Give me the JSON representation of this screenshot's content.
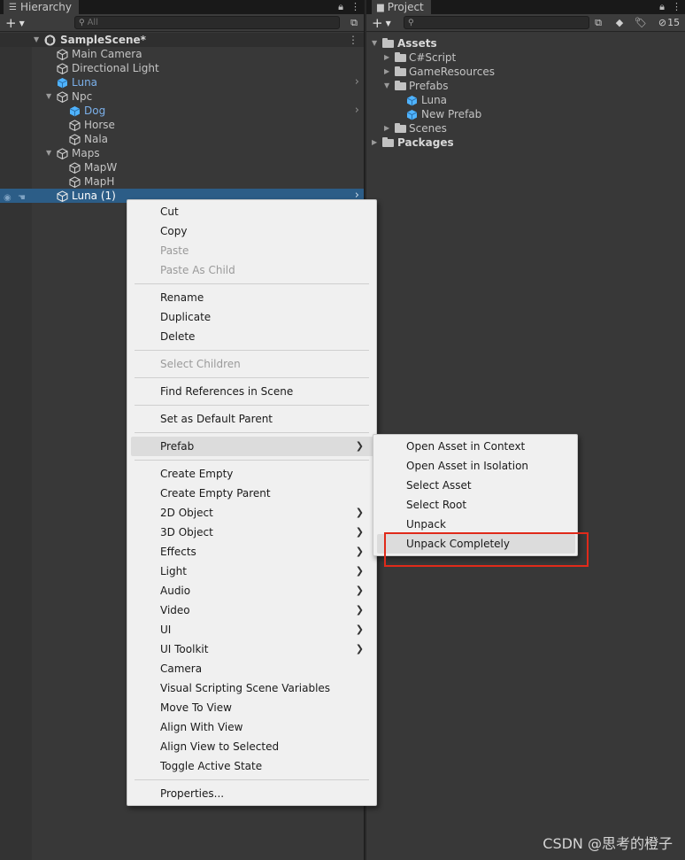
{
  "hierarchy": {
    "tab_title": "Hierarchy",
    "search_placeholder": "All",
    "scene_name": "SampleScene*",
    "items": [
      {
        "label": "Main Camera",
        "depth": 1
      },
      {
        "label": "Directional Light",
        "depth": 1
      },
      {
        "label": "Luna",
        "depth": 1,
        "prefab": true
      },
      {
        "label": "Npc",
        "depth": 1
      },
      {
        "label": "Dog",
        "depth": 2,
        "prefab": true
      },
      {
        "label": "Horse",
        "depth": 2
      },
      {
        "label": "Nala",
        "depth": 2
      },
      {
        "label": "Maps",
        "depth": 1
      },
      {
        "label": "MapW",
        "depth": 2
      },
      {
        "label": "MapH",
        "depth": 2
      },
      {
        "label": "Luna (1)",
        "depth": 1,
        "selected": true
      }
    ]
  },
  "project": {
    "tab_title": "Project",
    "hidden_count": "15",
    "tree": {
      "assets": "Assets",
      "csharp": "C#Script",
      "gameresources": "GameResources",
      "prefabs": "Prefabs",
      "prefab_luna": "Luna",
      "prefab_new": "New Prefab",
      "scenes": "Scenes",
      "packages": "Packages"
    }
  },
  "context_menu": {
    "cut": "Cut",
    "copy": "Copy",
    "paste": "Paste",
    "paste_as_child": "Paste As Child",
    "rename": "Rename",
    "duplicate": "Duplicate",
    "delete": "Delete",
    "select_children": "Select Children",
    "find_references": "Find References in Scene",
    "set_default_parent": "Set as Default Parent",
    "prefab": "Prefab",
    "create_empty": "Create Empty",
    "create_empty_parent": "Create Empty Parent",
    "obj_2d": "2D Object",
    "obj_3d": "3D Object",
    "effects": "Effects",
    "light": "Light",
    "audio": "Audio",
    "video": "Video",
    "ui": "UI",
    "ui_toolkit": "UI Toolkit",
    "camera": "Camera",
    "visual_scripting": "Visual Scripting Scene Variables",
    "move_to_view": "Move To View",
    "align_with_view": "Align With View",
    "align_view_to_selected": "Align View to Selected",
    "toggle_active": "Toggle Active State",
    "properties": "Properties..."
  },
  "prefab_submenu": {
    "open_context": "Open Asset in Context",
    "open_isolation": "Open Asset in Isolation",
    "select_asset": "Select Asset",
    "select_root": "Select Root",
    "unpack": "Unpack",
    "unpack_completely": "Unpack Completely"
  },
  "watermark": "CSDN @思考的橙子",
  "colors": {
    "selection": "#2c5d87",
    "prefab_text": "#7bb0ea",
    "prefab_icon": "#4fb3ff",
    "highlight_box": "#e02a1a"
  }
}
